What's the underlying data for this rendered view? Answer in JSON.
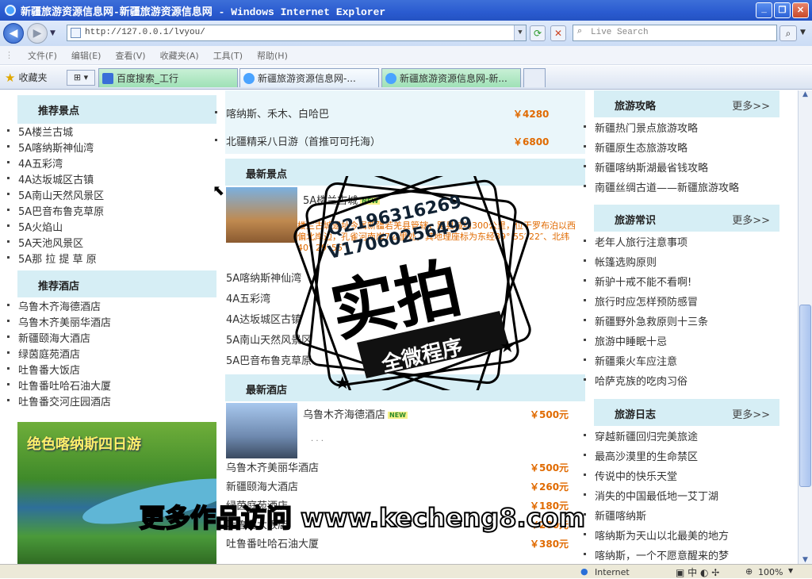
{
  "window": {
    "title": "新疆旅游资源信息网-新疆旅游资源信息网 - Windows Internet Explorer"
  },
  "nav": {
    "address": "http://127.0.0.1/lvyou/",
    "search_placeholder": "Live Search"
  },
  "menu": [
    "文件(F)",
    "编辑(E)",
    "查看(V)",
    "收藏夹(A)",
    "工具(T)",
    "帮助(H)"
  ],
  "favorites": {
    "label": "收藏夹",
    "tabs": [
      "百度搜索_工行",
      "新疆旅游资源信息网-...",
      "新疆旅游资源信息网-新..."
    ]
  },
  "left": {
    "spots_title": "推荐景点",
    "spots": [
      "5A楼兰古城",
      "5A喀纳斯神仙湾",
      "4A五彩湾",
      "4A达坂城区古镇",
      "5A南山天然风景区",
      "5A巴音布鲁克草原",
      "5A火焰山",
      "5A天池风景区",
      "5A那 拉 提 草 原"
    ],
    "hotels_title": "推荐酒店",
    "hotels": [
      "乌鲁木齐海德酒店",
      "乌鲁木齐美丽华酒店",
      "新疆颐海大酒店",
      "绿茵庭苑酒店",
      "吐鲁番大饭店",
      "吐鲁番吐哈石油大厦",
      "吐鲁番交河庄园酒店"
    ],
    "banner_text": "绝色喀纳斯四日游"
  },
  "middle": {
    "routes": [
      {
        "name": "喀纳斯、禾木、白哈巴",
        "price": "￥4280"
      },
      {
        "name": "北疆精采八日游（首推可可托海）",
        "price": "￥6800"
      }
    ],
    "new_spots_title": "最新景点",
    "featured_spot": {
      "name": "5A楼兰古城",
      "badge": "NEW",
      "desc": "楼兰古城遗址今属新疆若羌县管辖，距县城约300公里，位于罗布泊以西偏北岸边，孔雀河南岸7公里处，其地理座标为东经89° 55′ 22″、北纬40° 29′ 55″"
    },
    "spots": [
      "5A喀纳斯神仙湾",
      "4A五彩湾",
      "4A达坂城区古镇",
      "5A南山天然风景区",
      "5A巴音布鲁克草原"
    ],
    "new_hotels_title": "最新酒店",
    "featured_hotel": {
      "name": "乌鲁木齐海德酒店",
      "badge": "NEW",
      "price": "￥500元",
      "desc": ". . ."
    },
    "hotels": [
      {
        "name": "乌鲁木齐美丽华酒店",
        "price": "￥500元"
      },
      {
        "name": "新疆颐海大酒店",
        "price": "￥260元"
      },
      {
        "name": "绿茵庭苑酒店",
        "price": "￥180元"
      },
      {
        "name": "吐鲁番大饭店",
        "price": "￥200元"
      },
      {
        "name": "吐鲁番吐哈石油大厦",
        "price": "￥380元"
      }
    ]
  },
  "right": {
    "guide_title": "旅游攻略",
    "guide_more": "更多>>",
    "guide": [
      "新疆热门景点旅游攻略",
      "新疆原生态旅游攻略",
      "新疆喀纳斯湖最省钱攻略",
      "南疆丝绸古道——新疆旅游攻略"
    ],
    "tips_title": "旅游常识",
    "tips_more": "更多>>",
    "tips": [
      "老年人旅行注意事项",
      "帐篷选购原则",
      "新驴十戒不能不看啊!",
      "旅行时应怎样预防感冒",
      "新疆野外急救原则十三条",
      "旅游中睡眠十忌",
      "新疆乘火车应注意",
      "哈萨克族的吃肉习俗"
    ],
    "diary_title": "旅游日志",
    "diary_more": "更多>>",
    "diary": [
      "穿越新疆回归完美旅途",
      "最高沙漠里的生命禁区",
      "传说中的快乐天堂",
      "消失的中国最低地一艾丁湖",
      "新疆喀纳斯",
      "喀纳斯为天山以北最美的地方",
      "喀纳斯，一个不愿意醒来的梦"
    ]
  },
  "status": {
    "zone": "Internet",
    "zoom": "100%"
  },
  "watermark": {
    "contact1": "Q2196316269",
    "contact2": "V17060256499",
    "stamp_big": "实拍",
    "stamp_small": "全微程序",
    "footer": "更多作品访问 www.kecheng8.com"
  }
}
